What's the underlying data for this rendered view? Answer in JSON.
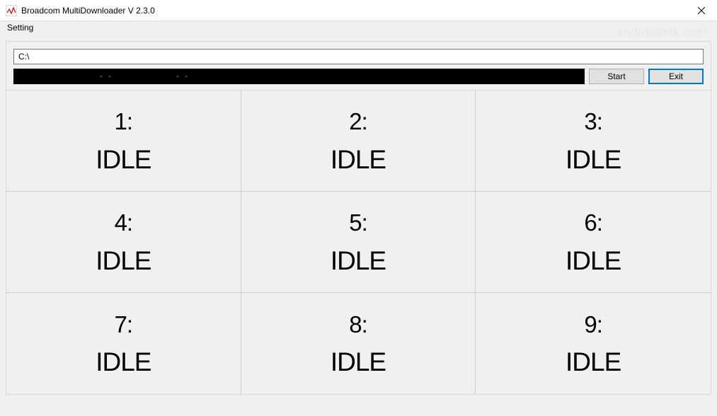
{
  "window": {
    "title": "Broadcom MultiDownloader V 2.3.0"
  },
  "menu": {
    "setting": "Setting"
  },
  "watermark": "androidmtk.com",
  "toolbar": {
    "path_value": "C:\\",
    "start_label": "Start",
    "exit_label": "Exit",
    "progress_tick1": "- -",
    "progress_tick2": "- -"
  },
  "slots": [
    {
      "number": "1:",
      "status": "IDLE"
    },
    {
      "number": "2:",
      "status": "IDLE"
    },
    {
      "number": "3:",
      "status": "IDLE"
    },
    {
      "number": "4:",
      "status": "IDLE"
    },
    {
      "number": "5:",
      "status": "IDLE"
    },
    {
      "number": "6:",
      "status": "IDLE"
    },
    {
      "number": "7:",
      "status": "IDLE"
    },
    {
      "number": "8:",
      "status": "IDLE"
    },
    {
      "number": "9:",
      "status": "IDLE"
    }
  ]
}
